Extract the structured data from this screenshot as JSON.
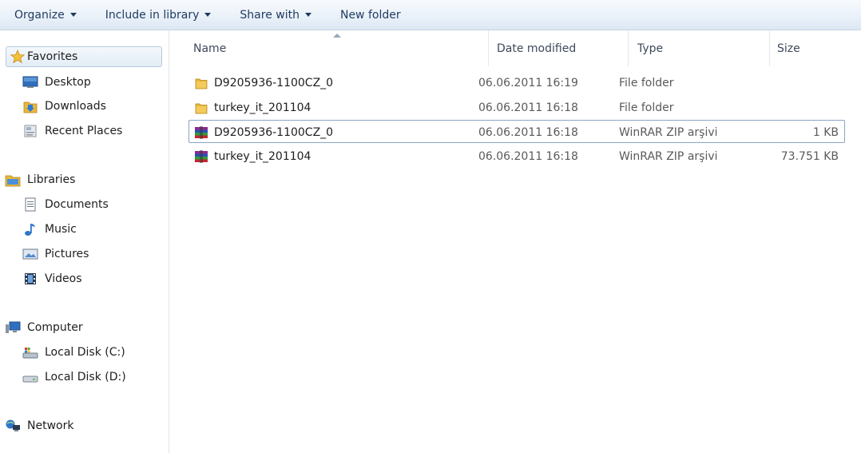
{
  "toolbar": {
    "organize": "Organize",
    "include_in_library": "Include in library",
    "share_with": "Share with",
    "new_folder": "New folder"
  },
  "nav": {
    "favorites": "Favorites",
    "desktop": "Desktop",
    "downloads": "Downloads",
    "recent_places": "Recent Places",
    "libraries": "Libraries",
    "documents": "Documents",
    "music": "Music",
    "pictures": "Pictures",
    "videos": "Videos",
    "computer": "Computer",
    "local_disk_c": "Local Disk (C:)",
    "local_disk_d": "Local Disk (D:)",
    "network": "Network"
  },
  "columns": {
    "name": "Name",
    "date_modified": "Date modified",
    "type": "Type",
    "size": "Size"
  },
  "files": [
    {
      "name": "D9205936-1100CZ_0",
      "date": "06.06.2011 16:19",
      "type": "File folder",
      "size": ""
    },
    {
      "name": "turkey_it_201104",
      "date": "06.06.2011 16:18",
      "type": "File folder",
      "size": ""
    },
    {
      "name": "D9205936-1100CZ_0",
      "date": "06.06.2011 16:18",
      "type": "WinRAR ZIP arşivi",
      "size": "1 KB"
    },
    {
      "name": "turkey_it_201104",
      "date": "06.06.2011 16:18",
      "type": "WinRAR ZIP arşivi",
      "size": "73.751 KB"
    }
  ],
  "colors": {
    "toolbar_text": "#1e3a5f",
    "folder": "#e8b83a",
    "selection_border": "#8aa6c4"
  },
  "icons": {
    "favorites": "star-icon",
    "desktop": "desktop-icon",
    "downloads": "downloads-icon",
    "recent_places": "recent-places-icon",
    "libraries": "libraries-icon",
    "documents": "documents-icon",
    "music": "music-note-icon",
    "pictures": "pictures-icon",
    "videos": "video-film-icon",
    "computer": "computer-icon",
    "local_disk_c": "system-disk-icon",
    "local_disk_d": "disk-drive-icon",
    "network": "network-icon",
    "folder": "folder-icon",
    "archive": "winrar-archive-icon"
  }
}
